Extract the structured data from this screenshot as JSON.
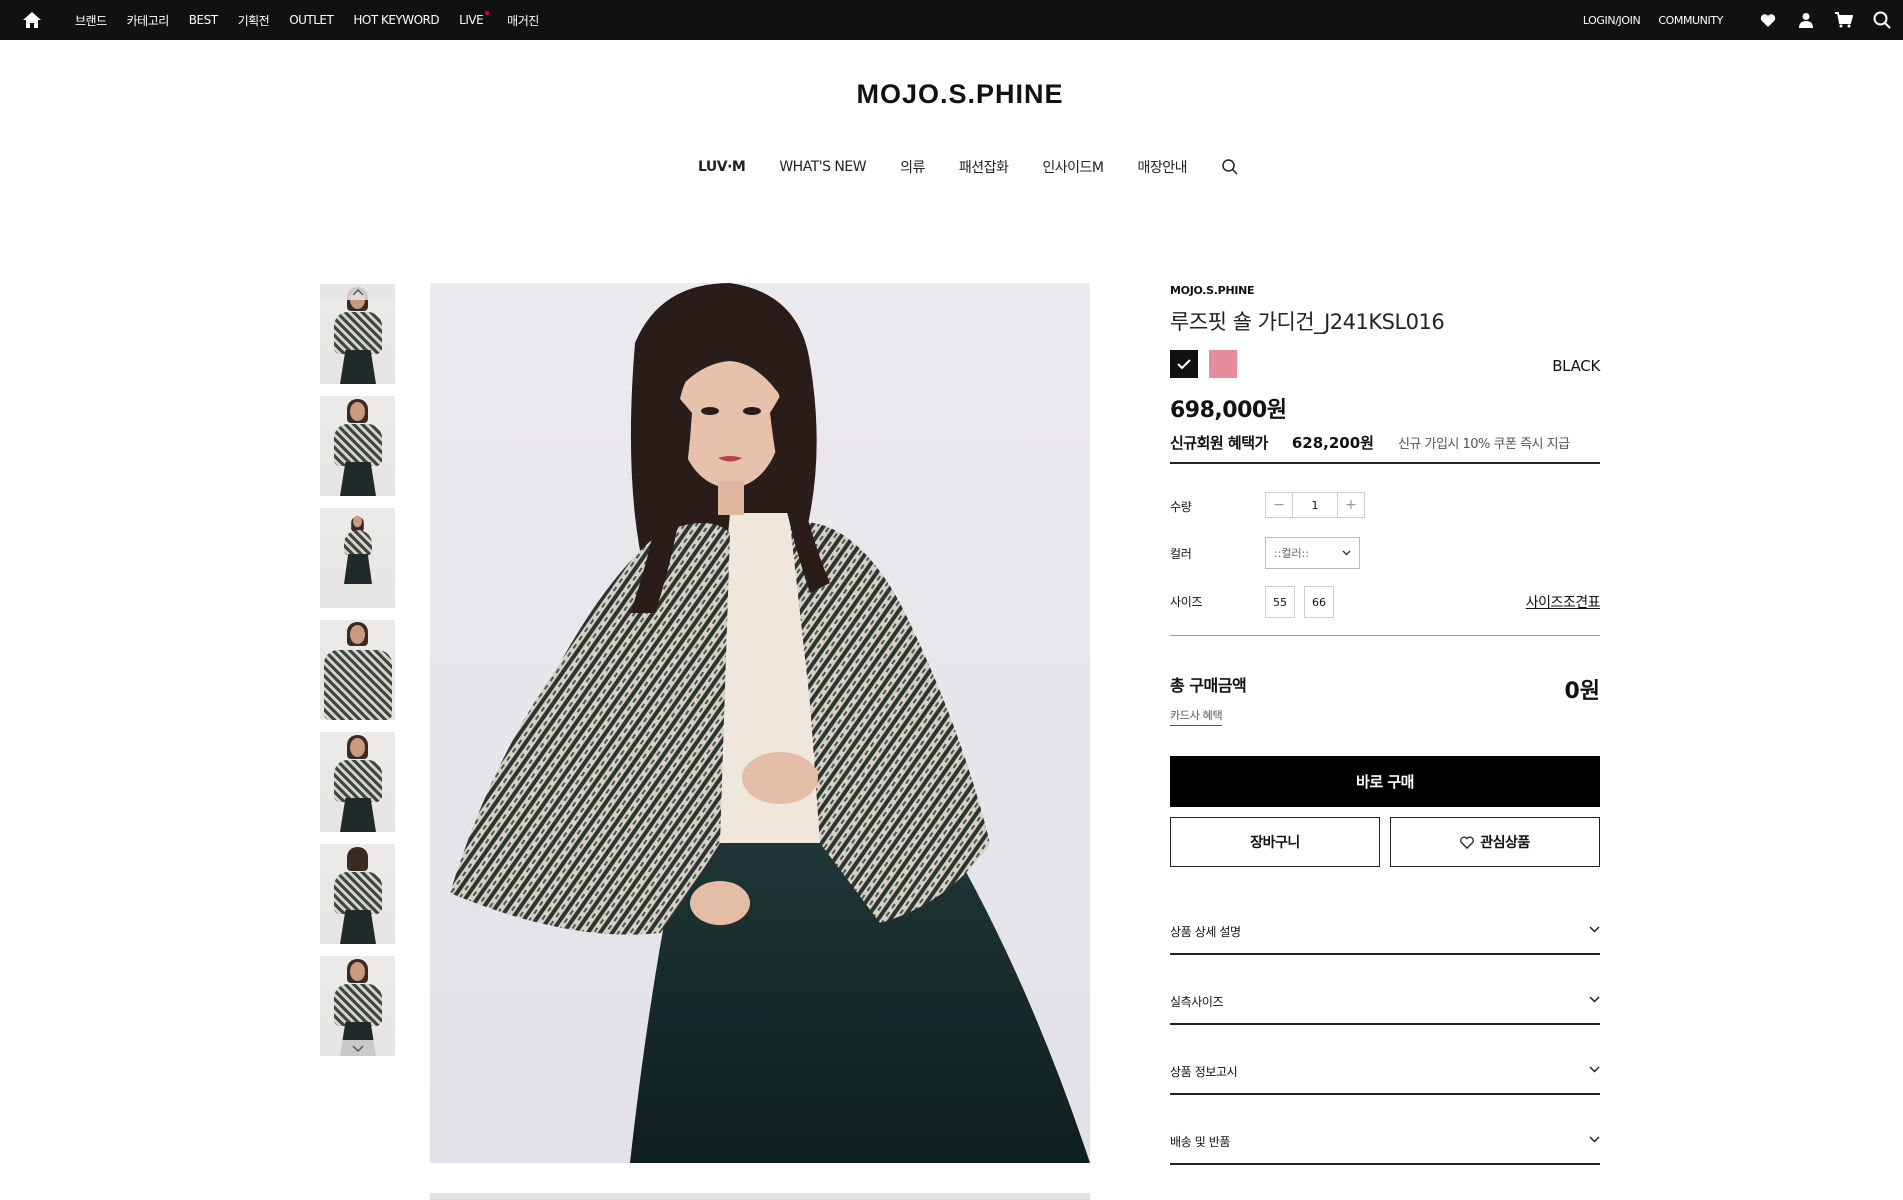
{
  "topbar": {
    "nav": [
      "브랜드",
      "카테고리",
      "BEST",
      "기획전",
      "OUTLET",
      "HOT KEYWORD",
      "LIVE",
      "매거진"
    ],
    "right": [
      "LOGIN/JOIN",
      "COMMUNITY"
    ],
    "icons": [
      "home-icon",
      "heart-icon",
      "user-icon",
      "cart-icon",
      "search-icon"
    ]
  },
  "header": {
    "logo": "MOJO.S.PHINE",
    "nav": [
      "LUV·M",
      "WHAT'S NEW",
      "의류",
      "패션잡화",
      "인사이드M",
      "매장안내"
    ]
  },
  "product": {
    "brand": "MOJO.S.PHINE",
    "name": "루즈핏 숄 가디건_J241KSL016",
    "selected_color": "BLACK",
    "swatch_colors": [
      "#111111",
      "#e58d9b"
    ],
    "price": "698,000원",
    "member_label": "신규회원 혜택가",
    "member_price": "628,200원",
    "member_note": "신규 가입시 10% 쿠폰 즉시 지급"
  },
  "options": {
    "qty_label": "수량",
    "qty_value": "1",
    "qty_minus": "−",
    "qty_plus": "+",
    "color_label": "컬러",
    "color_placeholder": "::컬러::",
    "size_label": "사이즈",
    "sizes": [
      "55",
      "66"
    ],
    "size_chart": "사이즈조견표"
  },
  "total": {
    "label": "총 구매금액",
    "value": "0원",
    "card_benefit": "카드사 혜택"
  },
  "actions": {
    "buy_now": "바로 구매",
    "cart": "장바구니",
    "wish": "관심상품"
  },
  "accordion": [
    "상품 상세 설명",
    "실측사이즈",
    "상품 정보고시",
    "배송 및 반품"
  ]
}
